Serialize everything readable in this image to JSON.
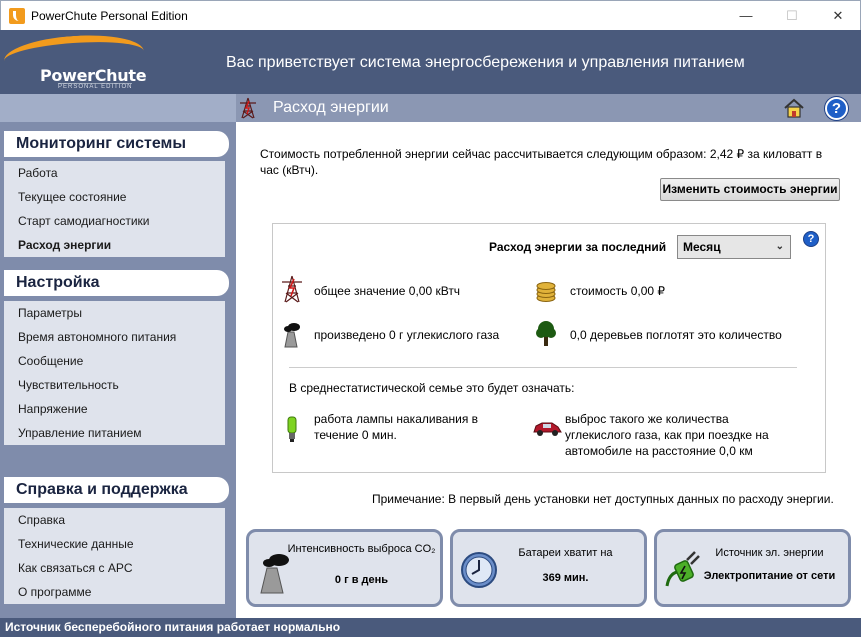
{
  "window": {
    "title": "PowerChute Personal Edition",
    "minimize": "—",
    "maximize": "☐",
    "close": "✕"
  },
  "banner": {
    "logo": "PowerChute",
    "logo_sub": "PERSONAL EDITION",
    "welcome": "Вас приветствует система энергосбережения и управления питанием"
  },
  "page": {
    "title": "Расход энергии"
  },
  "sidebar": {
    "sections": [
      {
        "title": "Мониторинг системы",
        "items": [
          {
            "label": "Работа"
          },
          {
            "label": "Текущее состояние"
          },
          {
            "label": "Старт самодиагностики"
          },
          {
            "label": "Расход энергии",
            "active": true
          }
        ]
      },
      {
        "title": "Настройка",
        "items": [
          {
            "label": "Параметры"
          },
          {
            "label": "Время автономного питания"
          },
          {
            "label": "Сообщение"
          },
          {
            "label": "Чувствительность"
          },
          {
            "label": "Напряжение"
          },
          {
            "label": "Управление питанием"
          }
        ]
      },
      {
        "title": "Справка и поддержка",
        "items": [
          {
            "label": "Справка"
          },
          {
            "label": "Технические данные"
          },
          {
            "label": "Как связаться с APC"
          },
          {
            "label": "О программе"
          }
        ]
      }
    ]
  },
  "main": {
    "cost_text": "Стоимость потребленной энергии сейчас рассчитывается следующим образом: 2,42 ₽ за киловатт в час (кВтч).",
    "change_cost_button": "Изменить стоимость энергии",
    "period_label": "Расход энергии за последний",
    "period_value": "Месяц",
    "help_glyph": "?",
    "metrics": {
      "total": "общее значение 0,00 кВтч",
      "cost": "стоимость 0,00 ₽",
      "co2": "произведено 0 г углекислого газа",
      "trees": "0,0 деревьев поглотят это количество"
    },
    "family_note": "В среднестатистической семье это будет означать:",
    "lamp": "работа лампы накаливания в течение 0 мин.",
    "car": "выброс такого же количества углекислого газа, как при поездке на автомобиле на расстояние 0,0 км",
    "note": "Примечание: В первый день установки нет доступных данных по расходу энергии."
  },
  "tiles": [
    {
      "label": "Интенсивность выброса CO₂",
      "value": "0 г в день",
      "icon": "factory-icon"
    },
    {
      "label": "Батареи хватит на",
      "value": "369 мин.",
      "icon": "clock-icon"
    },
    {
      "label": "Источник эл. энергии",
      "value": "Электропитание от сети",
      "icon": "plug-icon"
    }
  ],
  "statusbar": {
    "text": "Источник бесперебойного питания работает нормально"
  },
  "colors": {
    "banner": "#4a5a7c",
    "sidebar": "#7f8cab",
    "accent": "#f29b1d",
    "help_blue": "#1f5fc7"
  }
}
